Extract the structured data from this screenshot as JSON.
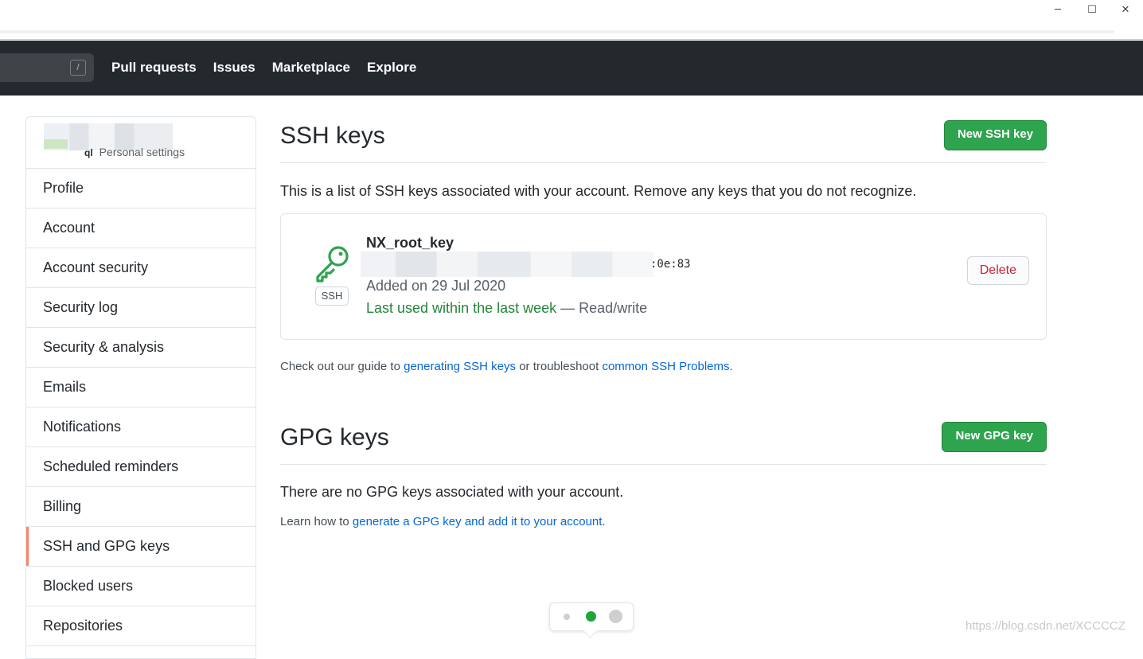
{
  "window": {
    "minimize_glyph": "─",
    "maximize_glyph": "☐",
    "close_glyph": "✕"
  },
  "header": {
    "search_shortcut": "/",
    "nav": [
      "Pull requests",
      "Issues",
      "Marketplace",
      "Explore"
    ]
  },
  "sidebar": {
    "subtitle": "Personal settings",
    "items": [
      "Profile",
      "Account",
      "Account security",
      "Security log",
      "Security & analysis",
      "Emails",
      "Notifications",
      "Scheduled reminders",
      "Billing",
      "SSH and GPG keys",
      "Blocked users",
      "Repositories"
    ],
    "selected": "SSH and GPG keys"
  },
  "ssh": {
    "title": "SSH keys",
    "new_button": "New SSH key",
    "description": "This is a list of SSH keys associated with your account. Remove any keys that you do not recognize.",
    "key": {
      "name": "NX_root_key",
      "fingerprint_visible": ":0e:83",
      "badge": "SSH",
      "added": "Added on 29 Jul 2020",
      "last_used": "Last used within the last week",
      "access": "— Read/write",
      "delete_button": "Delete"
    },
    "guide_prefix": "Check out our guide to ",
    "guide_link1": "generating SSH keys",
    "guide_middle": " or troubleshoot ",
    "guide_link2": "common SSH Problems",
    "guide_suffix": "."
  },
  "gpg": {
    "title": "GPG keys",
    "new_button": "New GPG key",
    "empty": "There are no GPG keys associated with your account.",
    "learn_prefix": "Learn how to ",
    "learn_link": "generate a GPG key and add it to your account",
    "learn_suffix": "."
  },
  "watermark": "https://blog.csdn.net/XCCCCZ",
  "colors": {
    "accent_green": "#2ea44f",
    "link_blue": "#0366d6",
    "selected_bar": "#f9826c",
    "header_bg": "#24292e",
    "dot_active": "#1fa53a"
  }
}
